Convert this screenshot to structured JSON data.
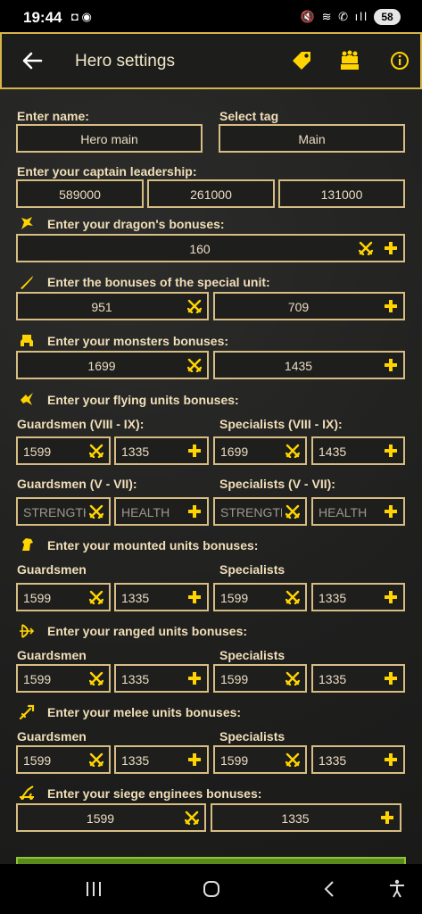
{
  "status": {
    "time": "19:44",
    "battery": "58",
    "left_icons": "◘ ◉",
    "right_icons": "🔇 ≋ ✆ ıll"
  },
  "appbar": {
    "title": "Hero settings"
  },
  "colors": {
    "accent": "#d7b44a",
    "icon": "#ffd400",
    "border": "#d8bd83"
  },
  "form": {
    "name_label": "Enter name:",
    "name_value": "Hero main",
    "tag_label": "Select tag",
    "tag_value": "Main",
    "leadership_label": "Enter your captain leadership:",
    "leadership": [
      "589000",
      "261000",
      "131000"
    ],
    "dragon_label": "Enter your dragon's bonuses:",
    "dragon_value": "160",
    "special_label": "Enter the bonuses of the special unit:",
    "special": [
      "951",
      "709"
    ],
    "monsters_label": "Enter your monsters bonuses:",
    "monsters": [
      "1699",
      "1435"
    ],
    "flying_label": "Enter your flying units bonuses:",
    "flying": {
      "guards_high_label": "Guardsmen (VIII - IX):",
      "spec_high_label": "Specialists (VIII - IX):",
      "guards_high": [
        "1599",
        "1335"
      ],
      "spec_high": [
        "1699",
        "1435"
      ],
      "guards_low_label": "Guardsmen (V - VII):",
      "spec_low_label": "Specialists (V - VII):",
      "placeholder_strength": "STRENGTH",
      "placeholder_health": "HEALTH"
    },
    "mounted_label": "Enter your mounted units bonuses:",
    "ranged_label": "Enter your ranged units bonuses:",
    "melee_label": "Enter your melee units bonuses:",
    "guardsmen": "Guardsmen",
    "specialists": "Specialists",
    "mounted": [
      "1599",
      "1335",
      "1599",
      "1335"
    ],
    "ranged": [
      "1599",
      "1335",
      "1599",
      "1335"
    ],
    "melee": [
      "1599",
      "1335",
      "1599",
      "1335"
    ],
    "siege_label": "Enter your siege enginees bonuses:",
    "siege": [
      "1599",
      "1335"
    ]
  }
}
